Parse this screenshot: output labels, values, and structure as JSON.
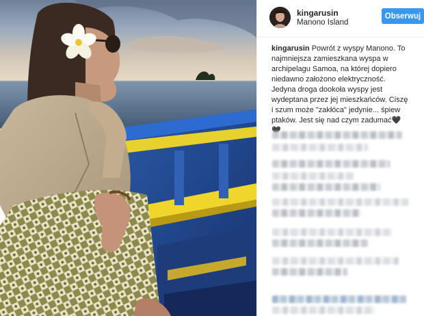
{
  "post": {
    "username": "kingarusin",
    "location": "Manono Island",
    "follow_label": "Obserwuj",
    "caption_user": "kingarusin",
    "caption_text": "Powrót z wyspy Manono. To najmniejsza zamieszkana wyspa w archipelagu Samoa, na której dopiero niedawno założono elektryczność. Jedyna droga dookoła wyspy jest wydeptana przez jej mieszkańców. Ciszę i szum może \"zakłóca\" jedynie... śpiew ptaków. Jest się nad czym zadumać🖤🖤"
  },
  "photo": {
    "description_icon": "photo"
  },
  "colors": {
    "accent": "#3897f0",
    "text": "#262626",
    "border": "#efefef"
  }
}
